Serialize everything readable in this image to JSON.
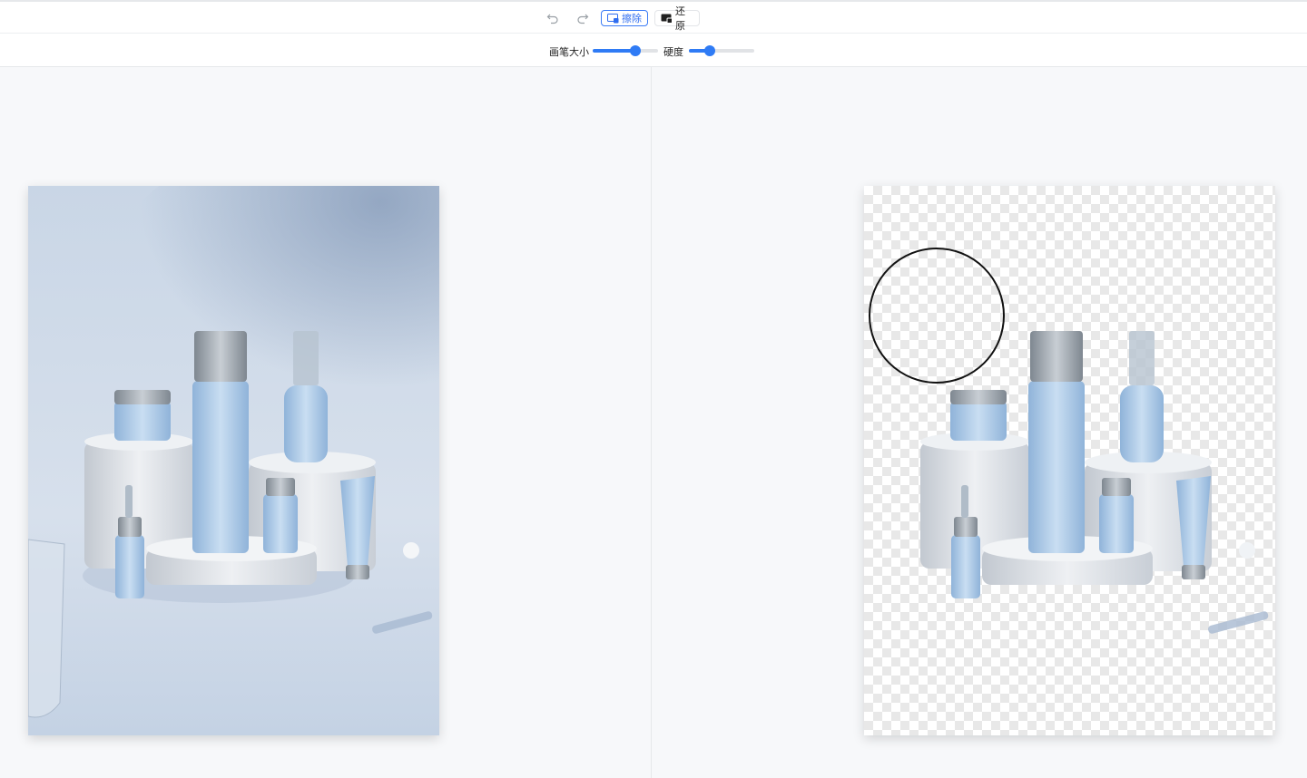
{
  "toolbar": {
    "undo_icon": "undo-icon",
    "redo_icon": "redo-icon",
    "erase_label": "擦除",
    "restore_label": "还原",
    "accent_color": "#2f6df0"
  },
  "brush": {
    "size_label": "画笔大小",
    "size_value": 0.65,
    "hardness_label": "硬度",
    "hardness_value": 0.32
  },
  "colors": {
    "slider": "#2f7bf5",
    "canvas_bg": "#f7f8fa"
  }
}
